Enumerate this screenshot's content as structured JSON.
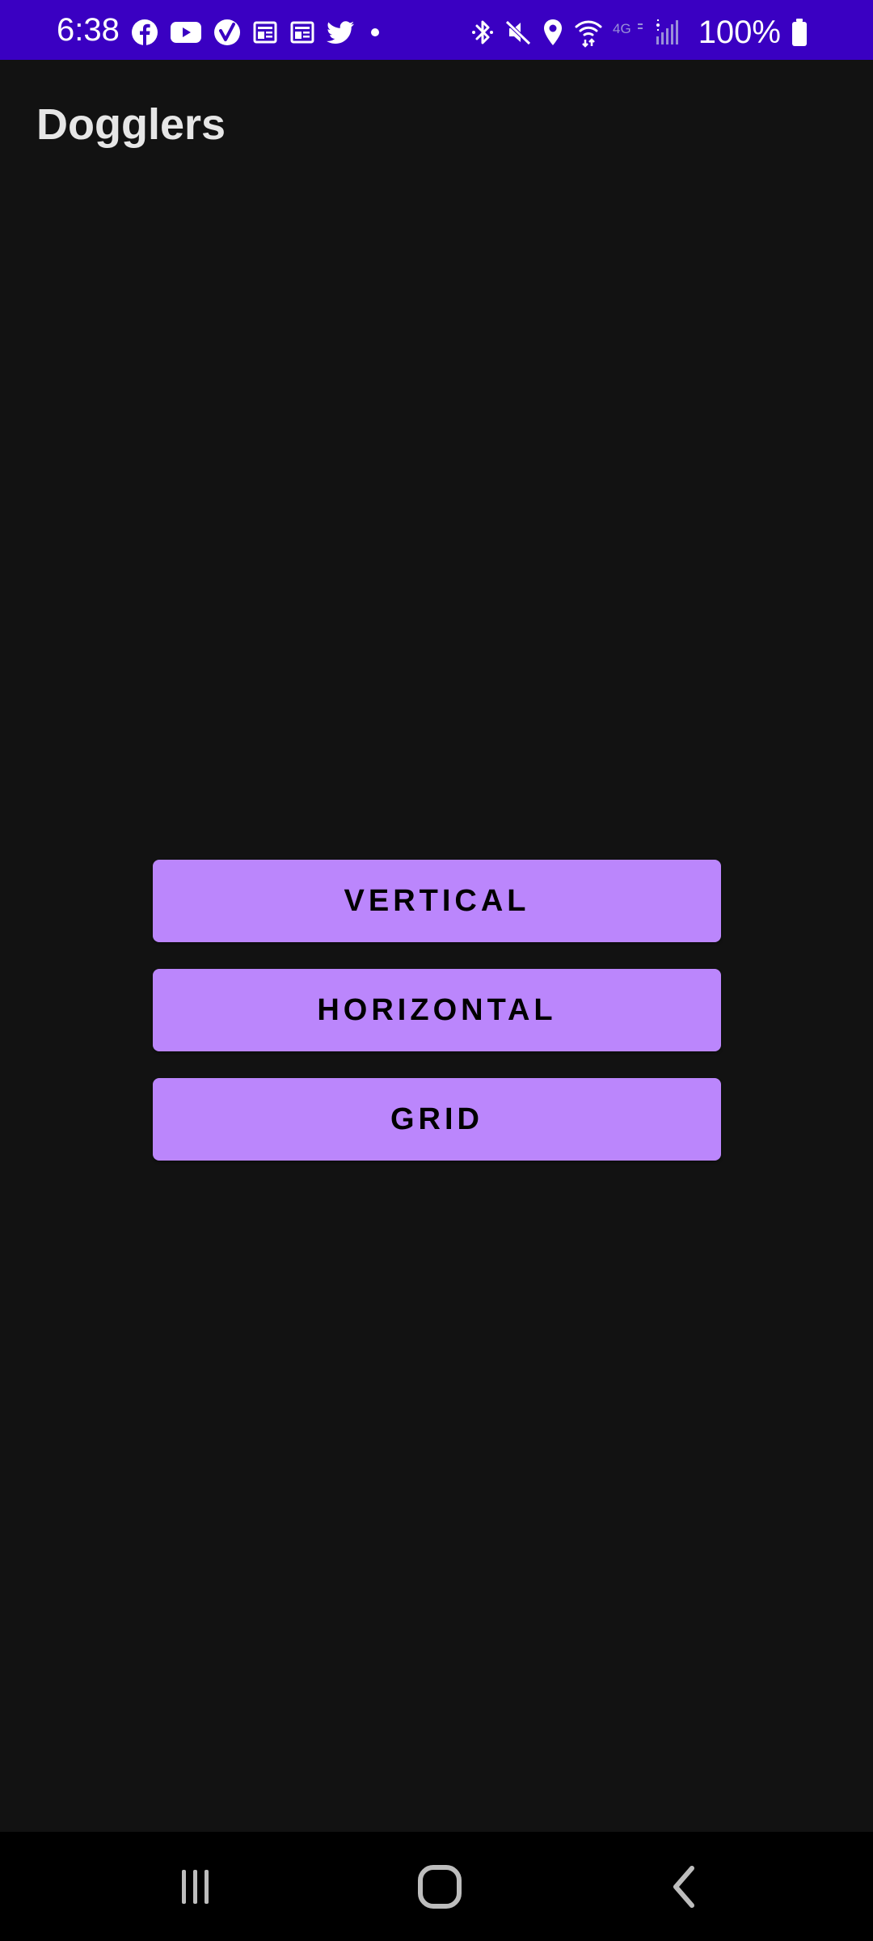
{
  "status_bar": {
    "time": "6:38",
    "battery_text": "100%",
    "background_color": "#3a00c2",
    "left_icons": [
      "facebook-icon",
      "youtube-icon",
      "verizon-icon",
      "news-icon",
      "news-icon",
      "twitter-icon",
      "dot-icon"
    ],
    "right_icons": [
      "bluetooth-icon",
      "mute-icon",
      "location-icon",
      "wifi-icon",
      "4g-lte-icon",
      "signal-icon",
      "battery-icon"
    ],
    "network_label": "4G"
  },
  "app": {
    "title": "Dogglers",
    "background_color": "#121212",
    "accent_color": "#bb86fc"
  },
  "buttons": {
    "vertical_label": "VERTICAL",
    "horizontal_label": "HORIZONTAL",
    "grid_label": "GRID"
  },
  "nav_bar": {
    "items": [
      "recents-icon",
      "home-icon",
      "back-icon"
    ]
  }
}
